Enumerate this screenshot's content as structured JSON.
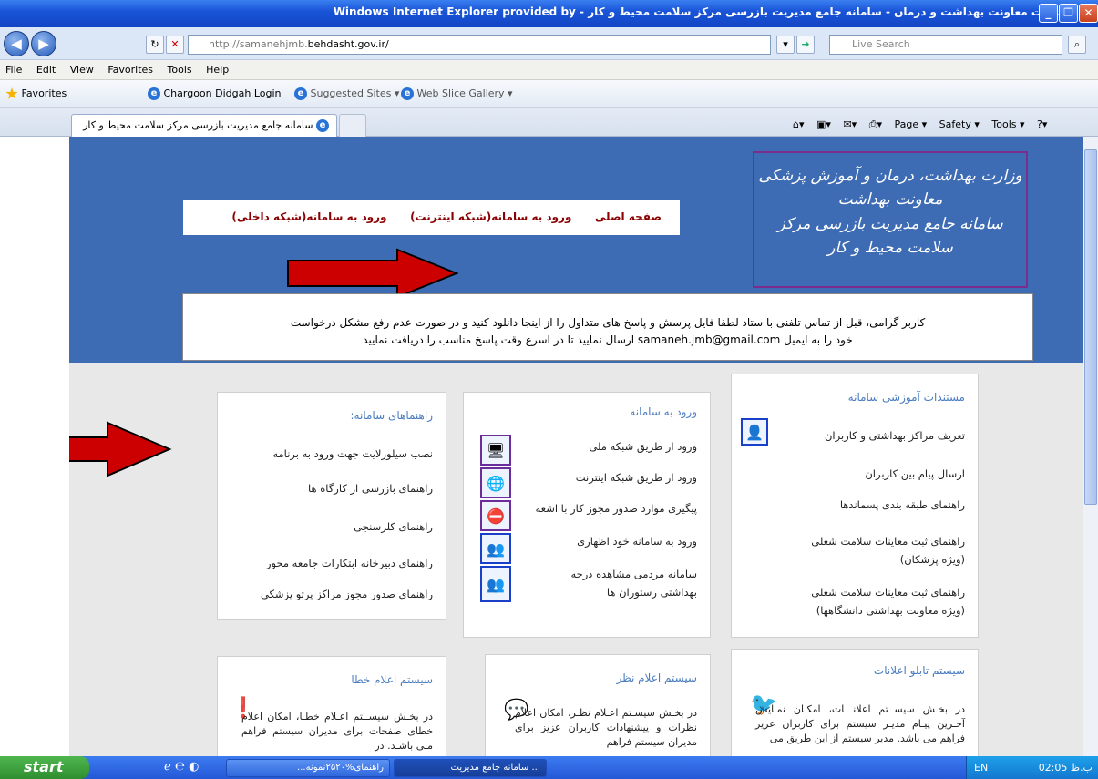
{
  "window": {
    "title": "اینترنت معاونت بهداشت و درمان - سامانه جامع مدیریت بازرسی مرکز سلامت محیط و کار - Windows Internet Explorer provided by"
  },
  "address": {
    "url_prefix": "http://samanehjmb.",
    "url_domain": "behdasht.gov.ir/",
    "search_placeholder": "Live Search"
  },
  "menu": [
    "File",
    "Edit",
    "View",
    "Favorites",
    "Tools",
    "Help"
  ],
  "favorites": {
    "label": "Favorites",
    "items": [
      "Chargoon Didgah Login",
      "Suggested Sites ▾",
      "Web Slice Gallery ▾"
    ]
  },
  "tab": {
    "title": "سامانه جامع مدیریت بازرسی مرکز سلامت محیط و کار"
  },
  "commands": [
    "Page ▾",
    "Safety ▾",
    "Tools ▾"
  ],
  "page": {
    "nav": [
      "صفحه اصلی",
      "ورود به سامانه(شبکه اینترنت)",
      "ورود به سامانه(شبکه داخلی)"
    ],
    "logo": [
      "وزارت بهداشت، درمان و آموزش پزشکی",
      "معاونت بهداشت",
      "سامانه جامع مدیریت بازرسی مرکز سلامت محیط و کار"
    ],
    "notice": {
      "line1": "کاربر گرامی، قبل از تماس تلفنی با ستاد لطفا فایل پرسش و پاسخ های متداول را از اینجا دانلود کنید و در صورت عدم رفع مشکل درخواست",
      "line2": "خود را به ایمیل samaneh.jmb@gmail.com ارسال نمایید تا در اسرع وقت پاسخ مناسب را دریافت نمایید"
    },
    "docs": {
      "title": "مستندات آموزشی سامانه",
      "items": [
        "تعریف مراکز بهداشتی و کاربران",
        "ارسال پیام بین کاربران",
        "راهنمای طبقه بندی پسماندها",
        "راهنمای ثبت معاینات سلامت شغلی",
        "(ویژه پزشکان)",
        "راهنمای ثبت معاینات سلامت شغلی",
        "(ویژه معاونت بهداشتی دانشگاهها)"
      ]
    },
    "login": {
      "title": "ورود به سامانه",
      "items": [
        "ورود از طریق شبکه ملی",
        "ورود از طریق شبکه اینترنت",
        "پیگیری موارد صدور مجوز کار با اشعه",
        "ورود به سامانه خود اظهاری",
        "سامانه مردمی مشاهده درجه",
        "بهداشتی رستوران ها"
      ]
    },
    "guides": {
      "title": "راهنماهای سامانه:",
      "items": [
        "نصب سیلورلایت جهت ورود به برنامه",
        "راهنمای بازرسی از کارگاه ها",
        "راهنمای کلرسنجی",
        "راهنمای دبیرخانه ابتکارات جامعه محور",
        "راهنمای صدور مجوز مراکز پرتو پزشکی"
      ]
    },
    "bulletin": {
      "title": "سیستم تابلو اعلانات",
      "text": "در بخـش سیســتم اعلانـــات، امکـان نمـایش آخـرین پیـام مدیـر سیستم برای کاربران عزیز فراهم می باشد. مدیر سیستم از این طریق می"
    },
    "feedback": {
      "title": "سیستم اعلام نظر",
      "text": "در بخـش سیسـتم اعـلام نظـر، امکان اعلام نظرات و پیشنهادات کاربران عزیز برای مدیران سیستم فراهم"
    },
    "errors": {
      "title": "سیستم اعلام خطا",
      "text": "در بخـش سیســتم اعـلام خطـا، امکان اعلام خطای صفحات برای مدیران سیستم فراهم مـی باشـد. در"
    }
  },
  "taskbar": {
    "start": "start",
    "tasks": [
      "راهنمای%۲۵۲۰نمونه...",
      "... سامانه جامع مدیریت"
    ],
    "lang": "EN",
    "clock": "02:05 ب.ظ"
  }
}
